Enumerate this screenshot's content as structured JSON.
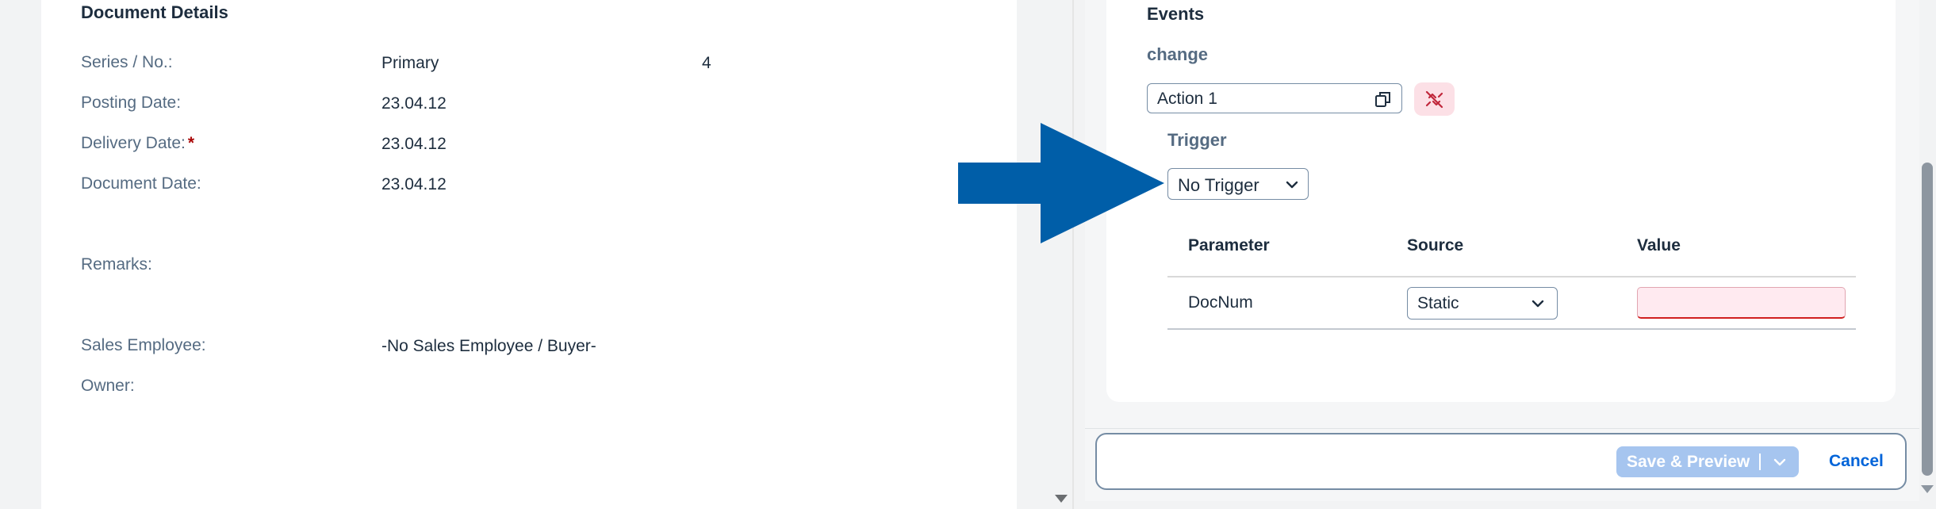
{
  "document_details": {
    "title": "Document Details",
    "fields": [
      {
        "label": "Series / No.:",
        "value": "Primary",
        "extra": "4"
      },
      {
        "label": "Posting Date:",
        "value": "23.04.12"
      },
      {
        "label": "Delivery Date:",
        "value": "23.04.12",
        "required_marker": "*"
      },
      {
        "label": "Document Date:",
        "value": "23.04.12"
      },
      {
        "label": "Remarks:",
        "value": ""
      },
      {
        "label": "Sales Employee:",
        "value": "-No Sales Employee / Buyer-"
      },
      {
        "label": "Owner:",
        "value": ""
      }
    ]
  },
  "events": {
    "title": "Events",
    "event_name": "change",
    "action_value": "Action 1",
    "trigger": {
      "label": "Trigger",
      "selected": "No Trigger"
    },
    "table": {
      "headers": [
        "Parameter",
        "Source",
        "Value"
      ],
      "rows": [
        {
          "parameter": "DocNum",
          "source": "Static",
          "value": ""
        }
      ]
    }
  },
  "footer": {
    "save_preview_label": "Save & Preview",
    "cancel_label": "Cancel"
  },
  "icons": {
    "copy": "copy-icon",
    "unlink": "unlink-icon",
    "chevron": "chevron-down-icon",
    "annotation": "annotation-arrow"
  },
  "colors": {
    "accent_blue": "#0064d9",
    "annotation_arrow": "#005ea8",
    "unlink_bg": "#fce0e6",
    "save_disabled_bg": "#a6c5ef",
    "error_underline": "#d11f1f"
  }
}
